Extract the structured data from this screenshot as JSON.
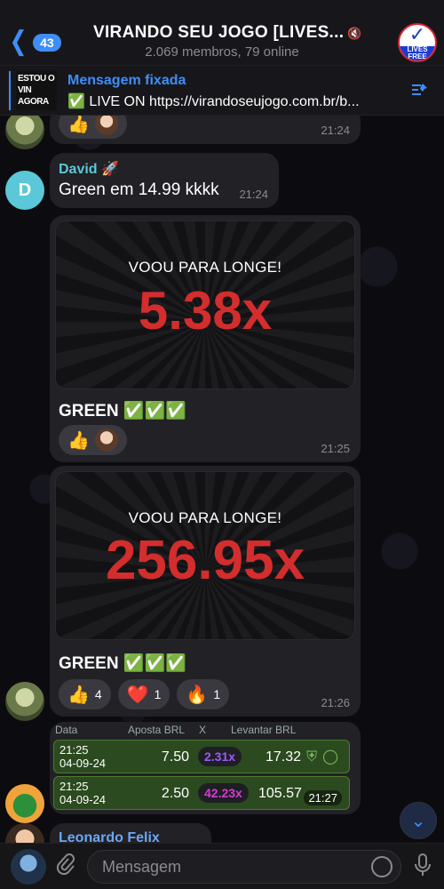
{
  "header": {
    "back_count": "43",
    "title": "VIRANDO SEU JOGO [LIVES...",
    "subtitle": "2.069 membros, 79 online",
    "avatar_top": "✓",
    "avatar_badge": "LIVES FREE"
  },
  "pinned": {
    "thumb_text": "ESTOU O VIN AGORA",
    "title": "Mensagem fixada",
    "text": "✅ LIVE ON https://virandoseujogo.com.br/b..."
  },
  "messages": {
    "m0": {
      "time": "21:24",
      "reaction_emoji": "👍"
    },
    "m1": {
      "sender": "David 🚀",
      "text": "Green em 14.99 kkkk",
      "time": "21:24",
      "avatar_letter": "D"
    },
    "m2": {
      "card_label": "VOOU PARA LONGE!",
      "multiplier": "5.38x",
      "caption": "GREEN ✅✅✅",
      "reaction_emoji": "👍",
      "time": "21:25"
    },
    "m3": {
      "card_label": "VOOU PARA LONGE!",
      "multiplier": "256.95x",
      "caption": "GREEN ✅✅✅",
      "time": "21:26",
      "reactions": [
        {
          "emoji": "👍",
          "count": "4"
        },
        {
          "emoji": "❤️",
          "count": "1"
        },
        {
          "emoji": "🔥",
          "count": "1"
        }
      ]
    },
    "m4": {
      "columns": [
        "Data",
        "Aposta BRL",
        "X",
        "Levantar BRL"
      ],
      "rows": [
        {
          "time": "21:25",
          "date": "04-09-24",
          "bet": "7.50",
          "mult": "2.31x",
          "mult_color": "#9b5cf6",
          "win": "17.32"
        },
        {
          "time": "21:25",
          "date": "04-09-24",
          "bet": "2.50",
          "mult": "42.23x",
          "mult_color": "#d63ad6",
          "win": "105.57"
        }
      ],
      "time": "21:27"
    },
    "m5": {
      "sender": "Leonardo Felix"
    }
  },
  "input": {
    "placeholder": "Mensagem"
  },
  "icons": {
    "back": "chevron-left-icon",
    "mute": "mute-icon",
    "pin": "pin-list-icon",
    "attach": "paperclip-icon",
    "sticker": "sticker-icon",
    "mic": "microphone-icon",
    "scroll": "chevron-down-icon"
  },
  "colors": {
    "accent": "#3f8ef7",
    "multiplier": "#d42d2d",
    "bet_row": "#2b4a1f"
  }
}
